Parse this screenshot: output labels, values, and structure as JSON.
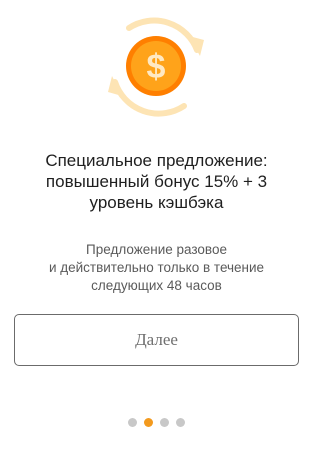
{
  "offer": {
    "icon": "dollar-cashback-icon",
    "title": "Специальное предложение:\nповышенный бонус 15% + 3\nуровень кэшбэка",
    "subtitle": "Предложение разовое\nи действительно только в течение\nследующих 48 часов",
    "next_label": "Далее"
  },
  "pagination": {
    "total": 4,
    "active_index": 1
  },
  "colors": {
    "accent": "#f39a1e",
    "coin_outer": "#ff7f00",
    "coin_inner": "#ffa31a",
    "arrows": "#fde4b4",
    "dot_inactive": "#c8c8c8",
    "button_border": "#6b6b6b"
  }
}
